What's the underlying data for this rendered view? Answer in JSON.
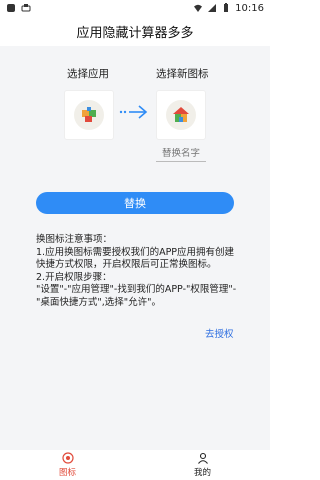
{
  "status_bar": {
    "time": "10:16"
  },
  "header": {
    "title": "应用隐藏计算器多多"
  },
  "main": {
    "select_app_label": "选择应用",
    "select_new_icon_label": "选择新图标",
    "name_input_placeholder": "替换名字",
    "replace_button_label": "替换",
    "notice": {
      "title": "换图标注意事项：",
      "item1": "1.应用换图标需要授权我们的APP应用拥有创建快捷方式权限，开启权限后可正常换图标。",
      "item2": "2.开启权限步骤：",
      "item3": "\"设置\"-\"应用管理\"-找到我们的APP-\"权限管理\"-\"桌面快捷方式\",选择\"允许\"。"
    },
    "authorize_link": "去授权"
  },
  "tabs": [
    {
      "label": "图标",
      "icon": "target-icon",
      "active": true,
      "active_color": "#e14b3b"
    },
    {
      "label": "我的",
      "icon": "user-icon",
      "active": false
    }
  ],
  "colors": {
    "accent_blue": "#2f8cf6",
    "active_tab": "#e14b3b",
    "link": "#2f6fe0"
  }
}
